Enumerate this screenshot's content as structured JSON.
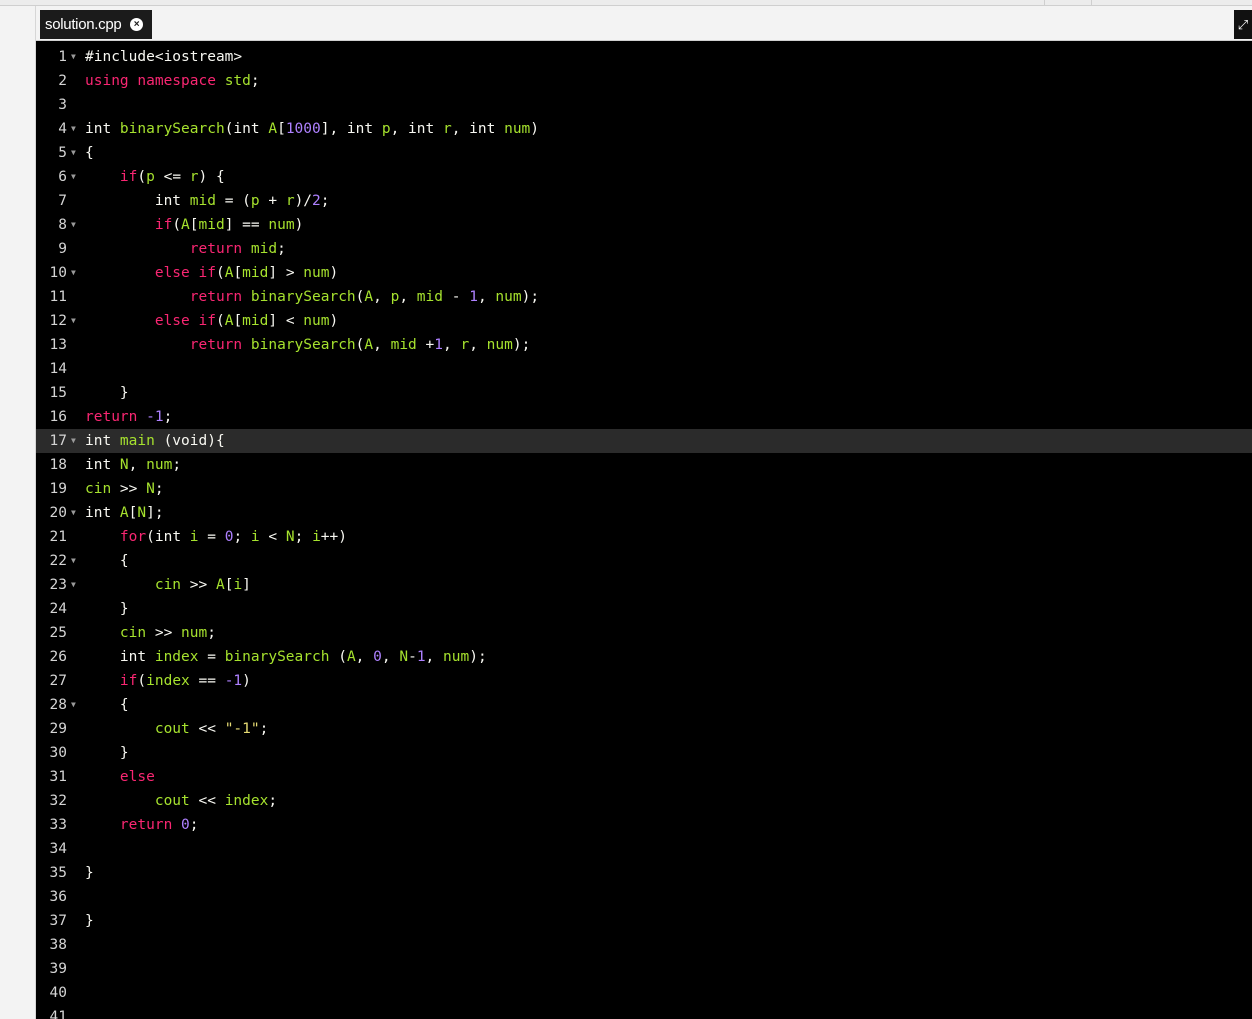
{
  "tab": {
    "title": "solution.cpp",
    "close_icon": "×"
  },
  "fullscreen_icon": "⤢",
  "editor": {
    "active_line": 17,
    "lines": [
      {
        "n": "1",
        "fold": true,
        "tokens": [
          [
            "w",
            "#include<iostream>"
          ]
        ]
      },
      {
        "n": "2",
        "fold": false,
        "tokens": [
          [
            "k",
            "using"
          ],
          [
            "w",
            " "
          ],
          [
            "k",
            "namespace"
          ],
          [
            "w",
            " "
          ],
          [
            "v",
            "std"
          ],
          [
            "w",
            ";"
          ]
        ]
      },
      {
        "n": "3",
        "fold": false,
        "tokens": []
      },
      {
        "n": "4",
        "fold": true,
        "tokens": [
          [
            "w",
            "int "
          ],
          [
            "f",
            "binarySearch"
          ],
          [
            "w",
            "(int "
          ],
          [
            "v",
            "A"
          ],
          [
            "w",
            "["
          ],
          [
            "n",
            "1000"
          ],
          [
            "w",
            "], int "
          ],
          [
            "v",
            "p"
          ],
          [
            "w",
            ", int "
          ],
          [
            "v",
            "r"
          ],
          [
            "w",
            ", int "
          ],
          [
            "v",
            "num"
          ],
          [
            "w",
            ")"
          ]
        ]
      },
      {
        "n": "5",
        "fold": true,
        "tokens": [
          [
            "w",
            "{"
          ]
        ]
      },
      {
        "n": "6",
        "fold": true,
        "tokens": [
          [
            "w",
            "    "
          ],
          [
            "k",
            "if"
          ],
          [
            "w",
            "("
          ],
          [
            "v",
            "p"
          ],
          [
            "w",
            " <= "
          ],
          [
            "v",
            "r"
          ],
          [
            "w",
            ") {"
          ]
        ]
      },
      {
        "n": "7",
        "fold": false,
        "tokens": [
          [
            "w",
            "        int "
          ],
          [
            "v",
            "mid"
          ],
          [
            "w",
            " = ("
          ],
          [
            "v",
            "p"
          ],
          [
            "w",
            " + "
          ],
          [
            "v",
            "r"
          ],
          [
            "w",
            ")/"
          ],
          [
            "n",
            "2"
          ],
          [
            "w",
            ";"
          ]
        ]
      },
      {
        "n": "8",
        "fold": true,
        "tokens": [
          [
            "w",
            "        "
          ],
          [
            "k",
            "if"
          ],
          [
            "w",
            "("
          ],
          [
            "v",
            "A"
          ],
          [
            "w",
            "["
          ],
          [
            "v",
            "mid"
          ],
          [
            "w",
            "] == "
          ],
          [
            "v",
            "num"
          ],
          [
            "w",
            ")"
          ]
        ]
      },
      {
        "n": "9",
        "fold": false,
        "tokens": [
          [
            "w",
            "            "
          ],
          [
            "k",
            "return"
          ],
          [
            "w",
            " "
          ],
          [
            "v",
            "mid"
          ],
          [
            "w",
            ";"
          ]
        ]
      },
      {
        "n": "10",
        "fold": true,
        "tokens": [
          [
            "w",
            "        "
          ],
          [
            "k",
            "else"
          ],
          [
            "w",
            " "
          ],
          [
            "k",
            "if"
          ],
          [
            "w",
            "("
          ],
          [
            "v",
            "A"
          ],
          [
            "w",
            "["
          ],
          [
            "v",
            "mid"
          ],
          [
            "w",
            "] > "
          ],
          [
            "v",
            "num"
          ],
          [
            "w",
            ")"
          ]
        ]
      },
      {
        "n": "11",
        "fold": false,
        "tokens": [
          [
            "w",
            "            "
          ],
          [
            "k",
            "return"
          ],
          [
            "w",
            " "
          ],
          [
            "f",
            "binarySearch"
          ],
          [
            "w",
            "("
          ],
          [
            "v",
            "A"
          ],
          [
            "w",
            ", "
          ],
          [
            "v",
            "p"
          ],
          [
            "w",
            ", "
          ],
          [
            "v",
            "mid"
          ],
          [
            "w",
            " - "
          ],
          [
            "n",
            "1"
          ],
          [
            "w",
            ", "
          ],
          [
            "v",
            "num"
          ],
          [
            "w",
            ");"
          ]
        ]
      },
      {
        "n": "12",
        "fold": true,
        "tokens": [
          [
            "w",
            "        "
          ],
          [
            "k",
            "else"
          ],
          [
            "w",
            " "
          ],
          [
            "k",
            "if"
          ],
          [
            "w",
            "("
          ],
          [
            "v",
            "A"
          ],
          [
            "w",
            "["
          ],
          [
            "v",
            "mid"
          ],
          [
            "w",
            "] < "
          ],
          [
            "v",
            "num"
          ],
          [
            "w",
            ")"
          ]
        ]
      },
      {
        "n": "13",
        "fold": false,
        "tokens": [
          [
            "w",
            "            "
          ],
          [
            "k",
            "return"
          ],
          [
            "w",
            " "
          ],
          [
            "f",
            "binarySearch"
          ],
          [
            "w",
            "("
          ],
          [
            "v",
            "A"
          ],
          [
            "w",
            ", "
          ],
          [
            "v",
            "mid"
          ],
          [
            "w",
            " +"
          ],
          [
            "n",
            "1"
          ],
          [
            "w",
            ", "
          ],
          [
            "v",
            "r"
          ],
          [
            "w",
            ", "
          ],
          [
            "v",
            "num"
          ],
          [
            "w",
            ");"
          ]
        ]
      },
      {
        "n": "14",
        "fold": false,
        "tokens": []
      },
      {
        "n": "15",
        "fold": false,
        "tokens": [
          [
            "w",
            "    }"
          ]
        ]
      },
      {
        "n": "16",
        "fold": false,
        "tokens": [
          [
            "k",
            "return"
          ],
          [
            "w",
            " "
          ],
          [
            "n",
            "-1"
          ],
          [
            "w",
            ";"
          ]
        ]
      },
      {
        "n": "17",
        "fold": true,
        "tokens": [
          [
            "w",
            "int "
          ],
          [
            "f",
            "main"
          ],
          [
            "w",
            " (void){"
          ]
        ]
      },
      {
        "n": "18",
        "fold": false,
        "tokens": [
          [
            "w",
            "int "
          ],
          [
            "v",
            "N"
          ],
          [
            "w",
            ", "
          ],
          [
            "v",
            "num"
          ],
          [
            "w",
            ";"
          ]
        ]
      },
      {
        "n": "19",
        "fold": false,
        "tokens": [
          [
            "v",
            "cin"
          ],
          [
            "w",
            " >> "
          ],
          [
            "v",
            "N"
          ],
          [
            "w",
            ";"
          ]
        ]
      },
      {
        "n": "20",
        "fold": true,
        "tokens": [
          [
            "w",
            "int "
          ],
          [
            "v",
            "A"
          ],
          [
            "w",
            "["
          ],
          [
            "v",
            "N"
          ],
          [
            "w",
            "];"
          ]
        ]
      },
      {
        "n": "21",
        "fold": false,
        "tokens": [
          [
            "w",
            "    "
          ],
          [
            "k",
            "for"
          ],
          [
            "w",
            "(int "
          ],
          [
            "v",
            "i"
          ],
          [
            "w",
            " = "
          ],
          [
            "n",
            "0"
          ],
          [
            "w",
            "; "
          ],
          [
            "v",
            "i"
          ],
          [
            "w",
            " < "
          ],
          [
            "v",
            "N"
          ],
          [
            "w",
            "; "
          ],
          [
            "v",
            "i"
          ],
          [
            "w",
            "++)"
          ]
        ]
      },
      {
        "n": "22",
        "fold": true,
        "tokens": [
          [
            "w",
            "    {"
          ]
        ]
      },
      {
        "n": "23",
        "fold": true,
        "tokens": [
          [
            "w",
            "        "
          ],
          [
            "v",
            "cin"
          ],
          [
            "w",
            " >> "
          ],
          [
            "v",
            "A"
          ],
          [
            "w",
            "["
          ],
          [
            "v",
            "i"
          ],
          [
            "w",
            "]"
          ]
        ]
      },
      {
        "n": "24",
        "fold": false,
        "tokens": [
          [
            "w",
            "    }"
          ]
        ]
      },
      {
        "n": "25",
        "fold": false,
        "tokens": [
          [
            "w",
            "    "
          ],
          [
            "v",
            "cin"
          ],
          [
            "w",
            " >> "
          ],
          [
            "v",
            "num"
          ],
          [
            "w",
            ";"
          ]
        ]
      },
      {
        "n": "26",
        "fold": false,
        "tokens": [
          [
            "w",
            "    int "
          ],
          [
            "v",
            "index"
          ],
          [
            "w",
            " = "
          ],
          [
            "f",
            "binarySearch"
          ],
          [
            "w",
            " ("
          ],
          [
            "v",
            "A"
          ],
          [
            "w",
            ", "
          ],
          [
            "n",
            "0"
          ],
          [
            "w",
            ", "
          ],
          [
            "v",
            "N"
          ],
          [
            "w",
            "-"
          ],
          [
            "n",
            "1"
          ],
          [
            "w",
            ", "
          ],
          [
            "v",
            "num"
          ],
          [
            "w",
            ");"
          ]
        ]
      },
      {
        "n": "27",
        "fold": false,
        "tokens": [
          [
            "w",
            "    "
          ],
          [
            "k",
            "if"
          ],
          [
            "w",
            "("
          ],
          [
            "v",
            "index"
          ],
          [
            "w",
            " == "
          ],
          [
            "n",
            "-1"
          ],
          [
            "w",
            ")"
          ]
        ]
      },
      {
        "n": "28",
        "fold": true,
        "tokens": [
          [
            "w",
            "    {"
          ]
        ]
      },
      {
        "n": "29",
        "fold": false,
        "tokens": [
          [
            "w",
            "        "
          ],
          [
            "v",
            "cout"
          ],
          [
            "w",
            " << "
          ],
          [
            "s",
            "\"-1\""
          ],
          [
            "w",
            ";"
          ]
        ]
      },
      {
        "n": "30",
        "fold": false,
        "tokens": [
          [
            "w",
            "    }"
          ]
        ]
      },
      {
        "n": "31",
        "fold": false,
        "tokens": [
          [
            "w",
            "    "
          ],
          [
            "k",
            "else"
          ]
        ]
      },
      {
        "n": "32",
        "fold": false,
        "tokens": [
          [
            "w",
            "        "
          ],
          [
            "v",
            "cout"
          ],
          [
            "w",
            " << "
          ],
          [
            "v",
            "index"
          ],
          [
            "w",
            ";"
          ]
        ]
      },
      {
        "n": "33",
        "fold": false,
        "tokens": [
          [
            "w",
            "    "
          ],
          [
            "k",
            "return"
          ],
          [
            "w",
            " "
          ],
          [
            "n",
            "0"
          ],
          [
            "w",
            ";"
          ]
        ]
      },
      {
        "n": "34",
        "fold": false,
        "tokens": []
      },
      {
        "n": "35",
        "fold": false,
        "tokens": [
          [
            "w",
            "}"
          ]
        ]
      },
      {
        "n": "36",
        "fold": false,
        "tokens": []
      },
      {
        "n": "37",
        "fold": false,
        "tokens": [
          [
            "w",
            "}"
          ]
        ]
      },
      {
        "n": "38",
        "fold": false,
        "tokens": []
      },
      {
        "n": "39",
        "fold": false,
        "tokens": []
      },
      {
        "n": "40",
        "fold": false,
        "tokens": []
      },
      {
        "n": "41",
        "fold": false,
        "tokens": []
      }
    ]
  }
}
